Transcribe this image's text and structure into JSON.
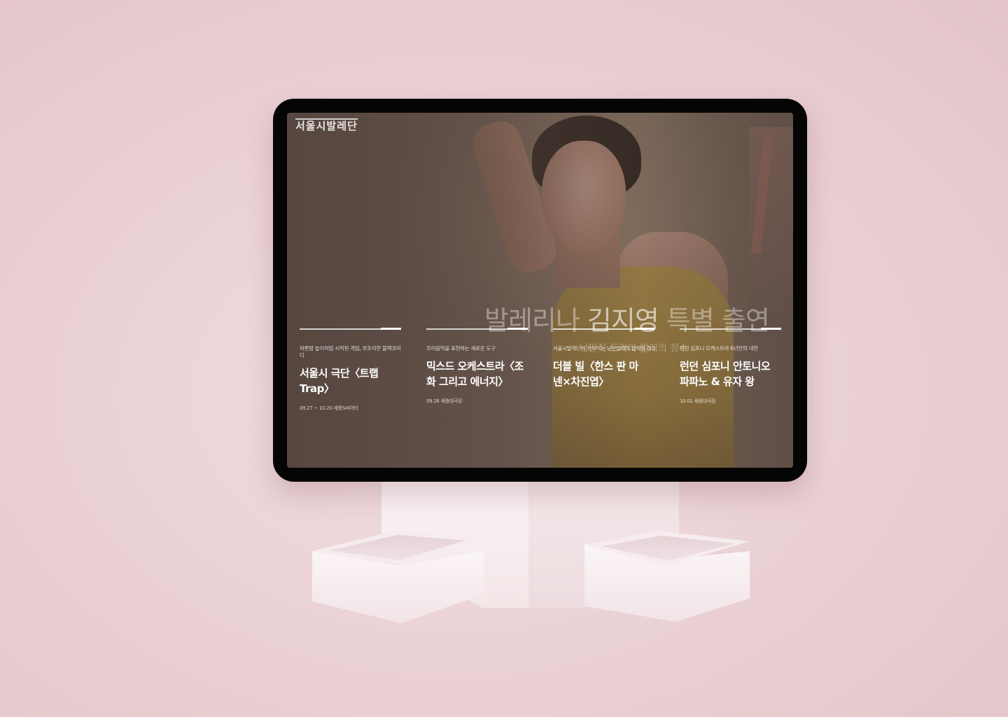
{
  "site": {
    "logo": "서울시발레단"
  },
  "hero": {
    "title_prefix": "발레리나 ",
    "title_emphasis": "김지영",
    "title_suffix": " 특별 출연",
    "subtitle": "낭만적 드라마 발레의 정수"
  },
  "programs": [
    {
      "category": "하룻밤 놀이처럼 시작된 게임, 부조리한 블랙코미디",
      "title": "서울시 극단〈트랩 Trap〉",
      "meta": "09.27 ~ 10.20 세종S씨어터"
    },
    {
      "category": "우리음악을 표현하는 새로운 도구",
      "title": "믹스드 오케스트라〈조화 그리고 에너지〉",
      "meta": "09.26 세종대극장"
    },
    {
      "category": "서울시발레단이 선보이는 낭만발레의 발레의 정수",
      "title": "더블 빌〈한스 판 마넨×차진엽〉",
      "meta": ""
    },
    {
      "category": "런던 심포니 오케스트라 6년만의 내한",
      "title": "런던 심포니 안토니오 파파노 & 유자 왕",
      "meta": "10.01 세종대극장"
    }
  ]
}
